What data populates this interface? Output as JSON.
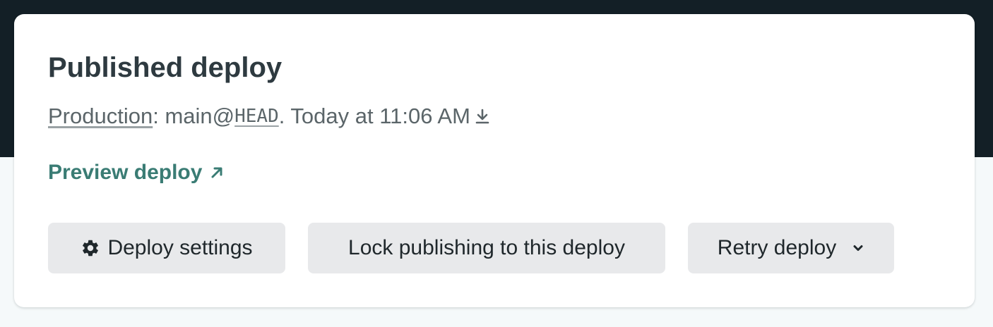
{
  "card": {
    "title": "Published deploy",
    "meta": {
      "context_link": "Production",
      "separator": ": ",
      "branch": "main@",
      "commit": "HEAD",
      "timestamp": ". Today at 11:06 AM",
      "download_icon": "download-icon"
    },
    "preview": {
      "label": "Preview deploy",
      "icon": "external-arrow-icon"
    },
    "actions": {
      "settings_label": "Deploy settings",
      "settings_icon": "gear-icon",
      "lock_label": "Lock publishing to this deploy",
      "retry_label": "Retry deploy",
      "retry_icon": "chevron-down-icon"
    }
  },
  "colors": {
    "header_band": "#131f26",
    "page_background": "#f5f9fa",
    "card_background": "#ffffff",
    "link_accent": "#3a7c74",
    "button_background": "#e8e9eb"
  }
}
